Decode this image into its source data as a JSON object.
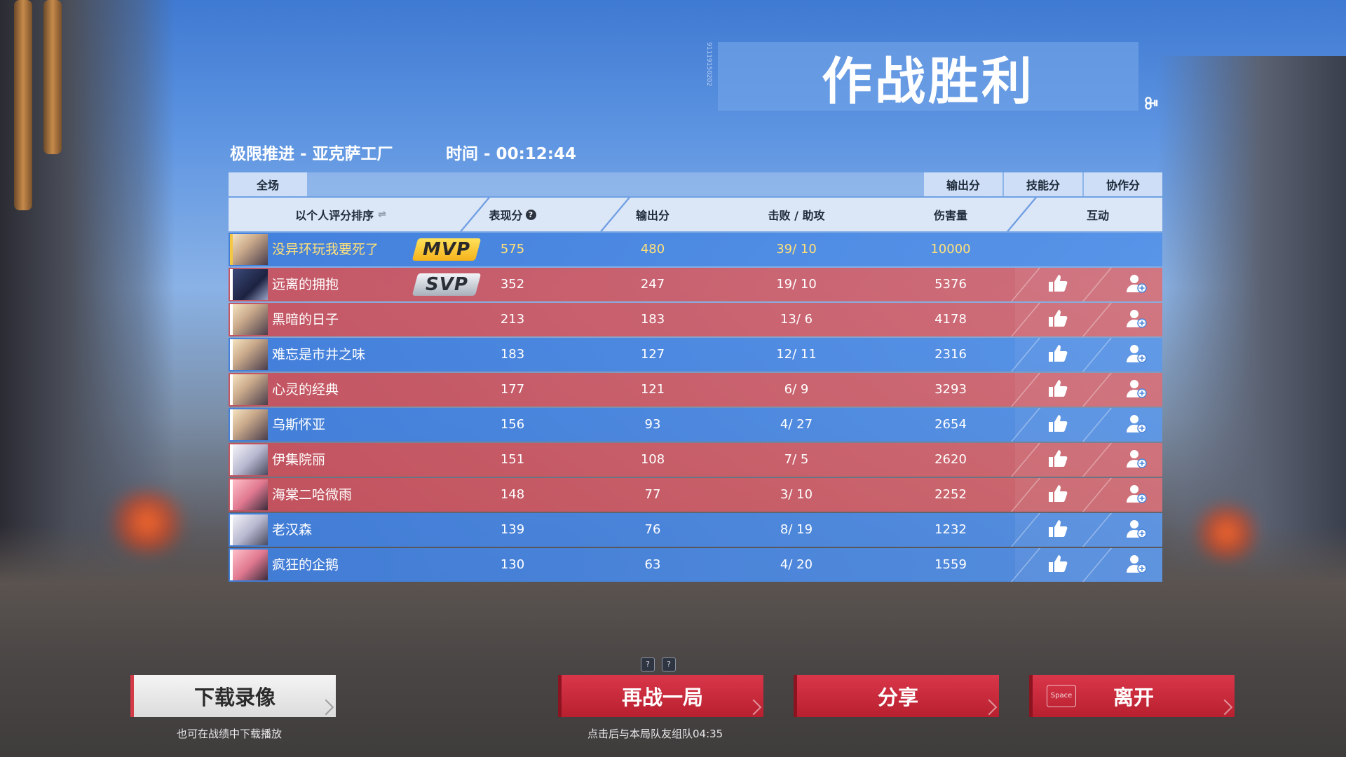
{
  "title": "作战胜利",
  "title_serial": "91119150202",
  "title_deco": "ꔻ",
  "match": {
    "mode_map": "极限推进 - 亚克萨工厂",
    "time": "时间 - 00:12:44"
  },
  "tabs": {
    "left": "全场",
    "right": [
      "输出分",
      "技能分",
      "协作分"
    ]
  },
  "columns": {
    "sort": "以个人评分排序",
    "perf": "表现分",
    "output": "输出分",
    "kda": "击败 / 助攻",
    "damage": "伤害量",
    "interact": "互动"
  },
  "help_glyph": "?",
  "sort_glyph": "⇌",
  "badges": {
    "mvp": "MVP",
    "svp": "SVP"
  },
  "players": [
    {
      "name": "没异环玩我要死了",
      "perf": "575",
      "output": "480",
      "kda": "39/ 10",
      "damage": "10000",
      "team": "blue"
    },
    {
      "name": "远离的拥抱",
      "perf": "352",
      "output": "247",
      "kda": "19/ 10",
      "damage": "5376",
      "team": "red"
    },
    {
      "name": "黑暗的日子",
      "perf": "213",
      "output": "183",
      "kda": "13/ 6",
      "damage": "4178",
      "team": "red"
    },
    {
      "name": "难忘是市井之味",
      "perf": "183",
      "output": "127",
      "kda": "12/ 11",
      "damage": "2316",
      "team": "blue"
    },
    {
      "name": "心灵的经典",
      "perf": "177",
      "output": "121",
      "kda": "6/ 9",
      "damage": "3293",
      "team": "red"
    },
    {
      "name": "乌斯怀亚",
      "perf": "156",
      "output": "93",
      "kda": "4/ 27",
      "damage": "2654",
      "team": "blue"
    },
    {
      "name": "伊集院丽",
      "perf": "151",
      "output": "108",
      "kda": "7/ 5",
      "damage": "2620",
      "team": "red"
    },
    {
      "name": "海棠二哈微雨",
      "perf": "148",
      "output": "77",
      "kda": "3/ 10",
      "damage": "2252",
      "team": "red"
    },
    {
      "name": "老汉森",
      "perf": "139",
      "output": "76",
      "kda": "8/ 19",
      "damage": "1232",
      "team": "blue"
    },
    {
      "name": "疯狂的企鹅",
      "perf": "130",
      "output": "63",
      "kda": "4/ 20",
      "damage": "1559",
      "team": "blue"
    }
  ],
  "buttons": {
    "download": "下载录像",
    "download_note": "也可在战绩中下载播放",
    "rematch": "再战一局",
    "rematch_note": "点击后与本局队友组队04:35",
    "share": "分享",
    "leave": "离开",
    "leave_key": "Space"
  },
  "qmarks": [
    "?",
    "?"
  ],
  "colors": {
    "team_blue": "#4a86dc",
    "team_red": "#cf5a66",
    "mvp_gold": "#f5c842",
    "accent_red": "#c82638"
  }
}
